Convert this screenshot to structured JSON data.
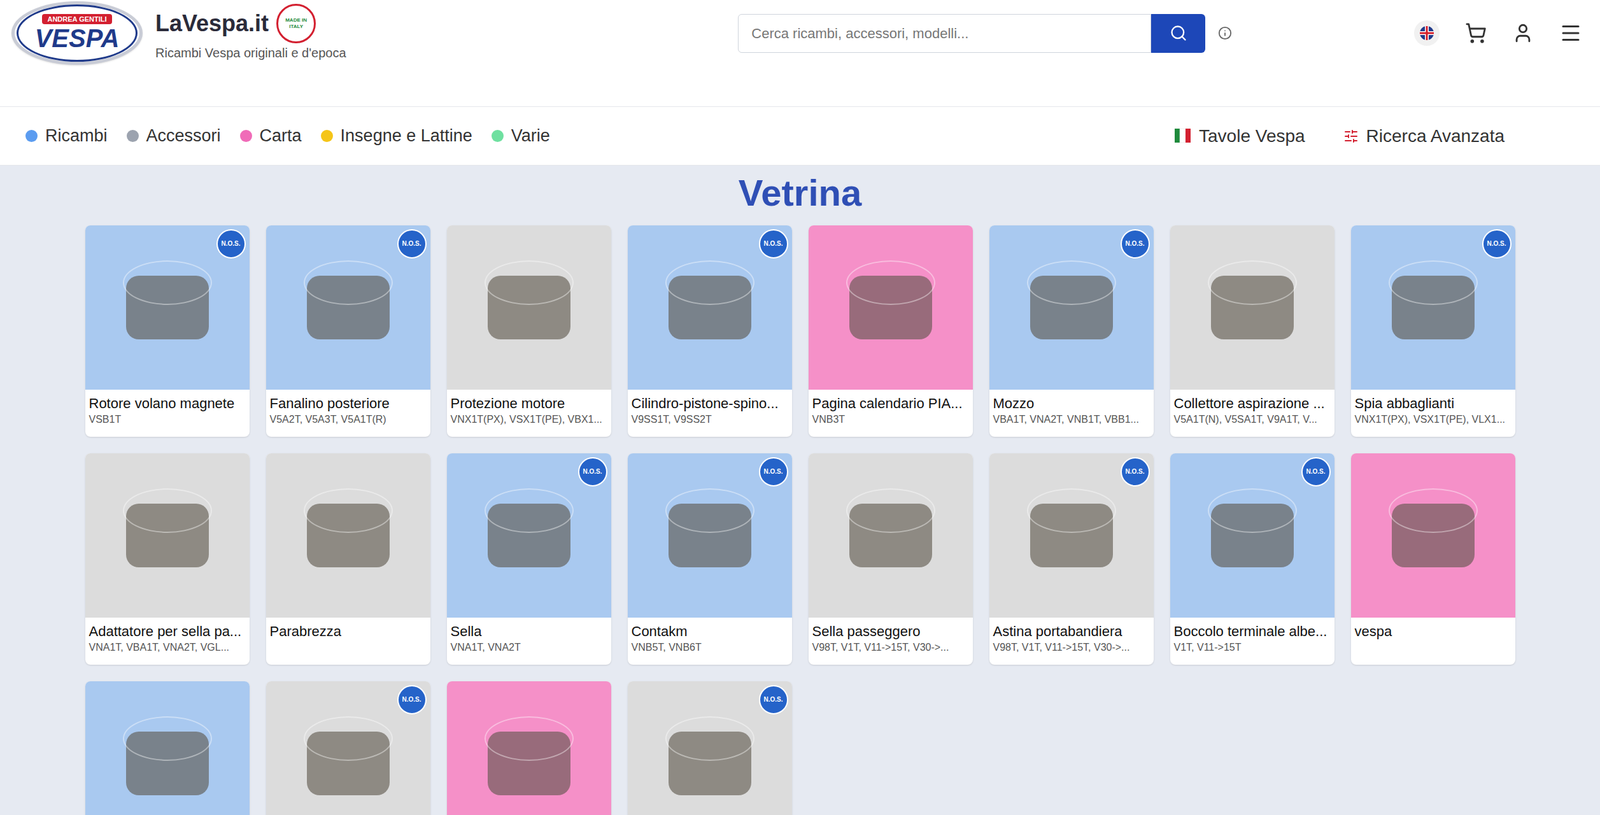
{
  "header": {
    "logo": {
      "top": "ANDREA GENTILI",
      "main": "VESPA"
    },
    "site_name": "LaVespa.it",
    "tagline": "Ricambi Vespa originali e d'epoca",
    "badge": "MADE IN ITALY"
  },
  "search": {
    "placeholder": "Cerca ricambi, accessori, modelli..."
  },
  "nav": {
    "categories": [
      {
        "label": "Ricambi",
        "color": "#5b9cf0"
      },
      {
        "label": "Accessori",
        "color": "#9ca3af"
      },
      {
        "label": "Carta",
        "color": "#f06bb8"
      },
      {
        "label": "Insegne e Lattine",
        "color": "#f5c518"
      },
      {
        "label": "Varie",
        "color": "#6fe0a0"
      }
    ],
    "links": [
      {
        "label": "Tavole Vespa",
        "kind": "flag"
      },
      {
        "label": "Ricerca Avanzata",
        "kind": "sliders"
      }
    ]
  },
  "section_title": "Vetrina",
  "nos_label": "N.O.S.",
  "products": [
    {
      "title": "Rotore volano magnete",
      "models": "VSB1T",
      "color": "#a9c9f0",
      "nos": true
    },
    {
      "title": "Fanalino posteriore",
      "models": "V5A2T, V5A3T, V5A1T(R)",
      "color": "#a9c9f0",
      "nos": true
    },
    {
      "title": "Protezione motore",
      "models": "VNX1T(PX), VSX1T(PE), VBX1...",
      "color": "#dcdcdc",
      "nos": false
    },
    {
      "title": "Cilindro-pistone-spino...",
      "models": "V9SS1T, V9SS2T",
      "color": "#a9c9f0",
      "nos": true
    },
    {
      "title": "Pagina calendario PIA...",
      "models": "VNB3T",
      "color": "#f590c8",
      "nos": false
    },
    {
      "title": "Mozzo",
      "models": "VBA1T, VNA2T, VNB1T, VBB1...",
      "color": "#a9c9f0",
      "nos": true
    },
    {
      "title": "Collettore aspirazione ...",
      "models": "V5A1T(N), V5SA1T, V9A1T, V...",
      "color": "#dcdcdc",
      "nos": false
    },
    {
      "title": "Spia abbaglianti",
      "models": "VNX1T(PX), VSX1T(PE), VLX1...",
      "color": "#a9c9f0",
      "nos": true
    },
    {
      "title": "Adattatore per sella pa...",
      "models": "VNA1T, VBA1T, VNA2T, VGL...",
      "color": "#dcdcdc",
      "nos": false
    },
    {
      "title": "Parabrezza",
      "models": "",
      "color": "#dcdcdc",
      "nos": false
    },
    {
      "title": "Sella",
      "models": "VNA1T, VNA2T",
      "color": "#a9c9f0",
      "nos": true
    },
    {
      "title": "Contakm",
      "models": "VNB5T, VNB6T",
      "color": "#a9c9f0",
      "nos": true
    },
    {
      "title": "Sella passeggero",
      "models": "V98T, V1T, V11->15T, V30->...",
      "color": "#dcdcdc",
      "nos": false
    },
    {
      "title": "Astina portabandiera",
      "models": "V98T, V1T, V11->15T, V30->...",
      "color": "#dcdcdc",
      "nos": true
    },
    {
      "title": "Boccolo terminale albe...",
      "models": "V1T, V11->15T",
      "color": "#a9c9f0",
      "nos": true
    },
    {
      "title": "vespa",
      "models": "",
      "color": "#f590c8",
      "nos": false
    },
    {
      "title": "",
      "models": "",
      "color": "#a9c9f0",
      "nos": false
    },
    {
      "title": "",
      "models": "",
      "color": "#dcdcdc",
      "nos": true
    },
    {
      "title": "",
      "models": "",
      "color": "#f590c8",
      "nos": false
    },
    {
      "title": "",
      "models": "",
      "color": "#dcdcdc",
      "nos": true
    }
  ]
}
